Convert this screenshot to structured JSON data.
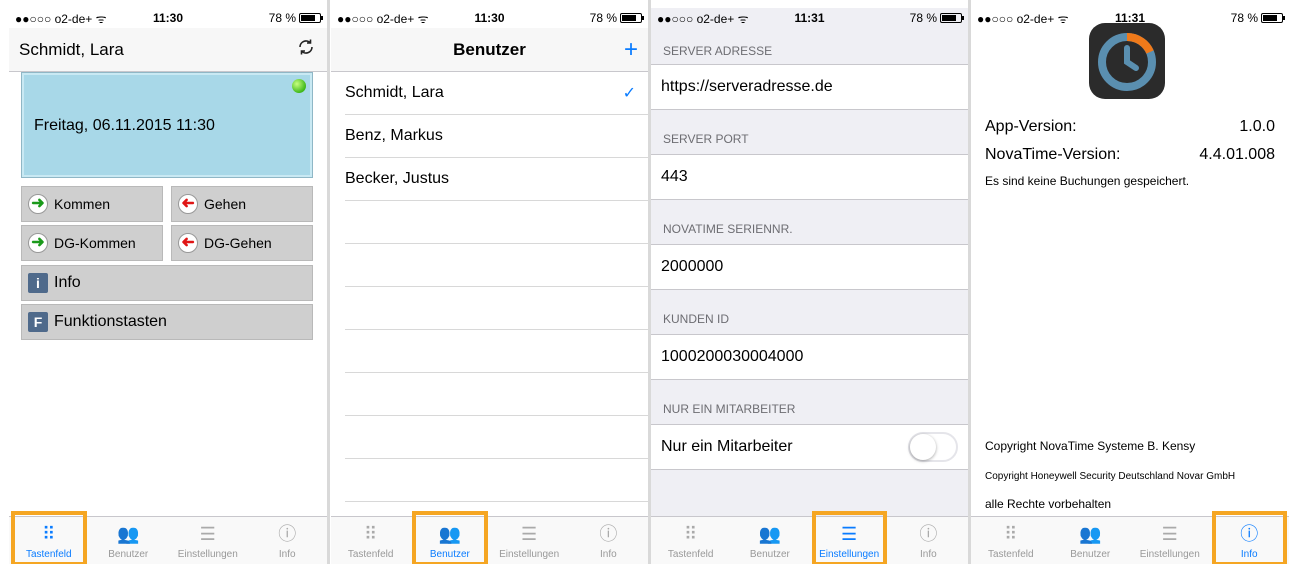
{
  "status_bars": [
    {
      "carrier": "●●○○○ o2-de+ ᯤ",
      "time": "11:30",
      "battery": "78 %"
    },
    {
      "carrier": "●●○○○ o2-de+ ᯤ",
      "time": "11:30",
      "battery": "78 %"
    },
    {
      "carrier": "●●○○○ o2-de+ ᯤ",
      "time": "11:31",
      "battery": "78 %"
    },
    {
      "carrier": "●●○○○ o2-de+ ᯤ",
      "time": "11:31",
      "battery": "78 %"
    }
  ],
  "battery_level": 0.78,
  "tabs": [
    "Tastenfeld",
    "Benutzer",
    "Einstellungen",
    "Info"
  ],
  "screen1": {
    "nav_title": "Schmidt, Lara",
    "refresh_icon": "refresh-icon",
    "datetime": "Freitag, 06.11.2015 11:30",
    "buttons": {
      "kommen": "Kommen",
      "gehen": "Gehen",
      "dg_kommen": "DG-Kommen",
      "dg_gehen": "DG-Gehen",
      "info": "Info",
      "funktion": "Funktionstasten"
    },
    "info_letter": "i",
    "funktion_letter": "F"
  },
  "screen2": {
    "nav_title": "Benutzer",
    "add_label": "+",
    "users": [
      "Schmidt, Lara",
      "Benz, Markus",
      "Becker, Justus"
    ],
    "check": "✓"
  },
  "screen3": {
    "sections": [
      {
        "header": "SERVER ADRESSE",
        "value": "https://serveradresse.de"
      },
      {
        "header": "SERVER PORT",
        "value": "443"
      },
      {
        "header": "NOVATIME SERIENNR.",
        "value": "2000000"
      },
      {
        "header": "KUNDEN ID",
        "value": "1000200030004000"
      },
      {
        "header": "NUR EIN MITARBEITER",
        "value": "Nur ein Mitarbeiter"
      }
    ],
    "toggle_on": false
  },
  "screen4": {
    "app_version_label": "App-Version:",
    "app_version": "1.0.0",
    "nova_version_label": "NovaTime-Version:",
    "nova_version": "4.4.01.008",
    "no_bookings": "Es sind keine Buchungen gespeichert.",
    "copyright1": "Copyright NovaTime Systeme B. Kensy",
    "copyright2": "Copyright Honeywell Security Deutschland Novar GmbH",
    "rights": "alle Rechte vorbehalten"
  },
  "colors": {
    "accent": "#0a7cff",
    "highlight": "#f5a623",
    "panel": "#a8d8e8"
  }
}
